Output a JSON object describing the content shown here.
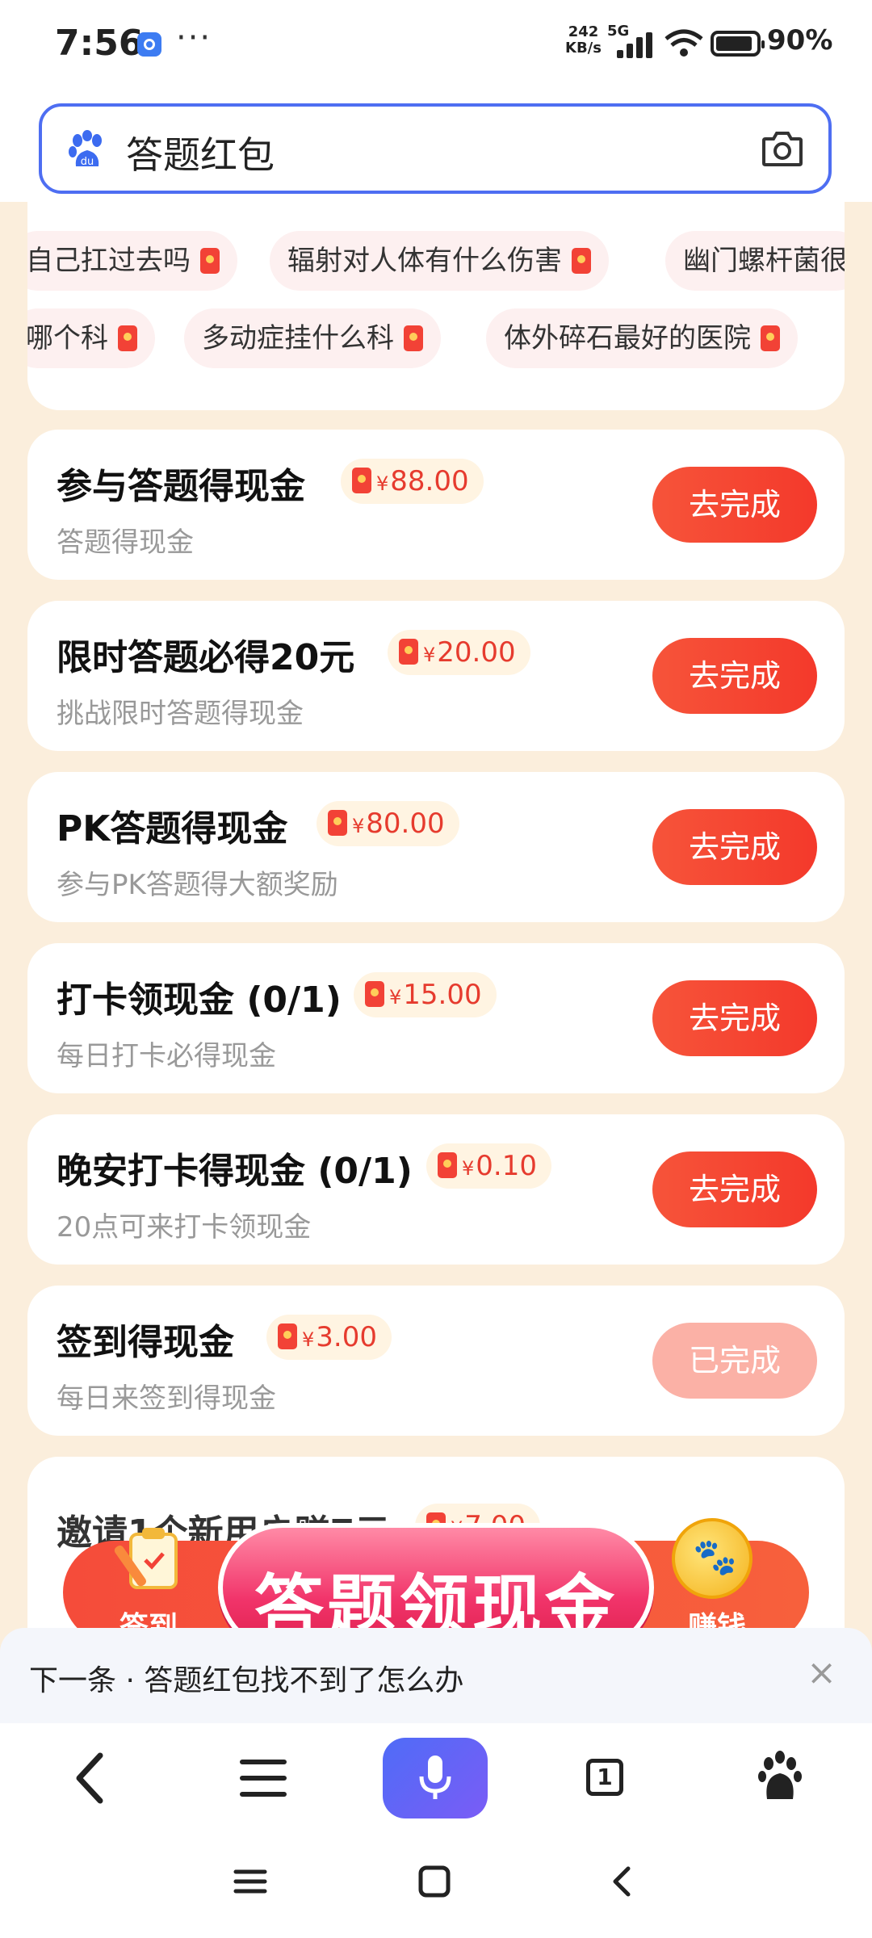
{
  "status_bar": {
    "time": "7:56",
    "dots": "···",
    "net_speed": "242\nKB/s",
    "net_type": "5G",
    "battery": "90%"
  },
  "search": {
    "query": "答题红包"
  },
  "tags": {
    "row1": [
      "自己扛过去吗",
      "辐射对人体有什么伤害",
      "幽门螺杆菌很"
    ],
    "row2": [
      "哪个科",
      "多动症挂什么科",
      "体外碎石最好的医院"
    ]
  },
  "tasks": [
    {
      "title": "参与答题得现金",
      "reward": "88.00",
      "subtitle": "答题得现金",
      "button": "去完成",
      "done": false
    },
    {
      "title": "限时答题必得20元",
      "reward": "20.00",
      "subtitle": "挑战限时答题得现金",
      "button": "去完成",
      "done": false
    },
    {
      "title": "PK答题得现金",
      "reward": "80.00",
      "subtitle": "参与PK答题得大额奖励",
      "button": "去完成",
      "done": false
    },
    {
      "title": "打卡领现金 (0/1)",
      "reward": "15.00",
      "subtitle": "每日打卡必得现金",
      "button": "去完成",
      "done": false
    },
    {
      "title": "晚安打卡得现金 (0/1)",
      "reward": "0.10",
      "subtitle": "20点可来打卡领现金",
      "button": "去完成",
      "done": false
    },
    {
      "title": "签到得现金",
      "reward": "3.00",
      "subtitle": "每日来签到得现金",
      "button": "已完成",
      "done": true
    }
  ],
  "partial_task": {
    "title": "邀请1个新用户赚7元",
    "reward": "7.00"
  },
  "yen_symbol": "¥",
  "banner": {
    "left_label": "签到",
    "main_label": "答题领现金",
    "right_label": "赚钱"
  },
  "next_bar": {
    "text": "下一条 · 答题红包找不到了怎么办",
    "close": "×"
  },
  "toolbar": {
    "tabs_count": "1"
  },
  "colors": {
    "accent_blue": "#4e6ef2",
    "button_red": "#f4392b",
    "done_button": "#fbb1a6",
    "reward_red": "#e63b2e",
    "page_bg": "#fbeedc"
  }
}
